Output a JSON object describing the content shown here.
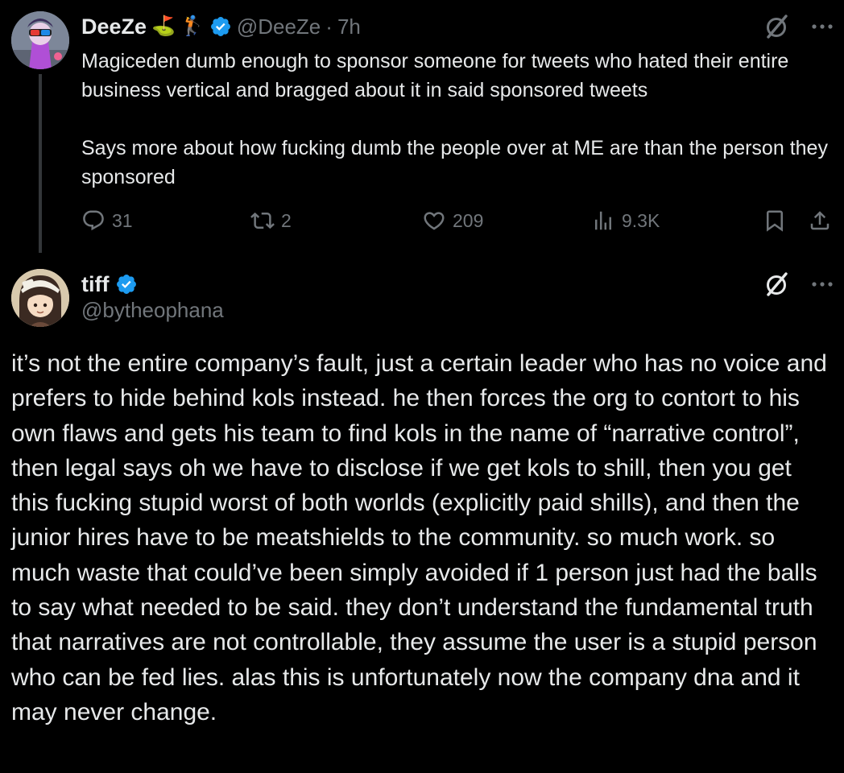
{
  "parent_tweet": {
    "author": {
      "display_name": "DeeZe",
      "emoji_1": "⛳",
      "emoji_2": "🏌",
      "handle": "@DeeZe",
      "separator": "·",
      "time": "7h",
      "verified": true
    },
    "text_paragraphs": [
      "Magiceden dumb enough to sponsor someone for tweets who hated their entire business vertical and bragged about it in said sponsored tweets",
      "Says more about how fucking dumb the people over at ME are than the person they sponsored"
    ],
    "stats": {
      "replies": "31",
      "reposts": "2",
      "likes": "209",
      "views": "9.3K"
    },
    "icons": {
      "grok": "grok-slash-icon",
      "more": "more-dots-icon",
      "reply": "reply-bubble-icon",
      "repost": "repost-arrows-icon",
      "like": "heart-icon",
      "views": "views-bars-icon",
      "bookmark": "bookmark-icon",
      "share": "share-upload-icon"
    }
  },
  "reply_tweet": {
    "author": {
      "display_name": "tiff",
      "handle": "@bytheophana",
      "verified": true
    },
    "text": "it’s not the entire company’s fault, just a certain leader who has no voice and prefers to hide behind kols instead. he then forces the org to contort to his own flaws and gets his team to find kols in the name of “narrative control”, then legal says oh we have to disclose if we get kols to shill, then you get this fucking stupid worst of both worlds (explicitly paid shills), and then the junior hires have to be meatshields to the community. so much work. so much waste that could’ve been simply avoided if 1 person just had the balls to say what needed to be said. they don’t understand the fundamental truth that narratives are not controllable, they assume the user is a stupid person who can be fed lies. alas this is unfortunately now the company dna and it may never change."
  },
  "colors": {
    "background": "#000000",
    "text_primary": "#e7e9ea",
    "text_secondary": "#71767b",
    "verified_blue": "#1d9bf0",
    "thread_line": "#333639"
  }
}
